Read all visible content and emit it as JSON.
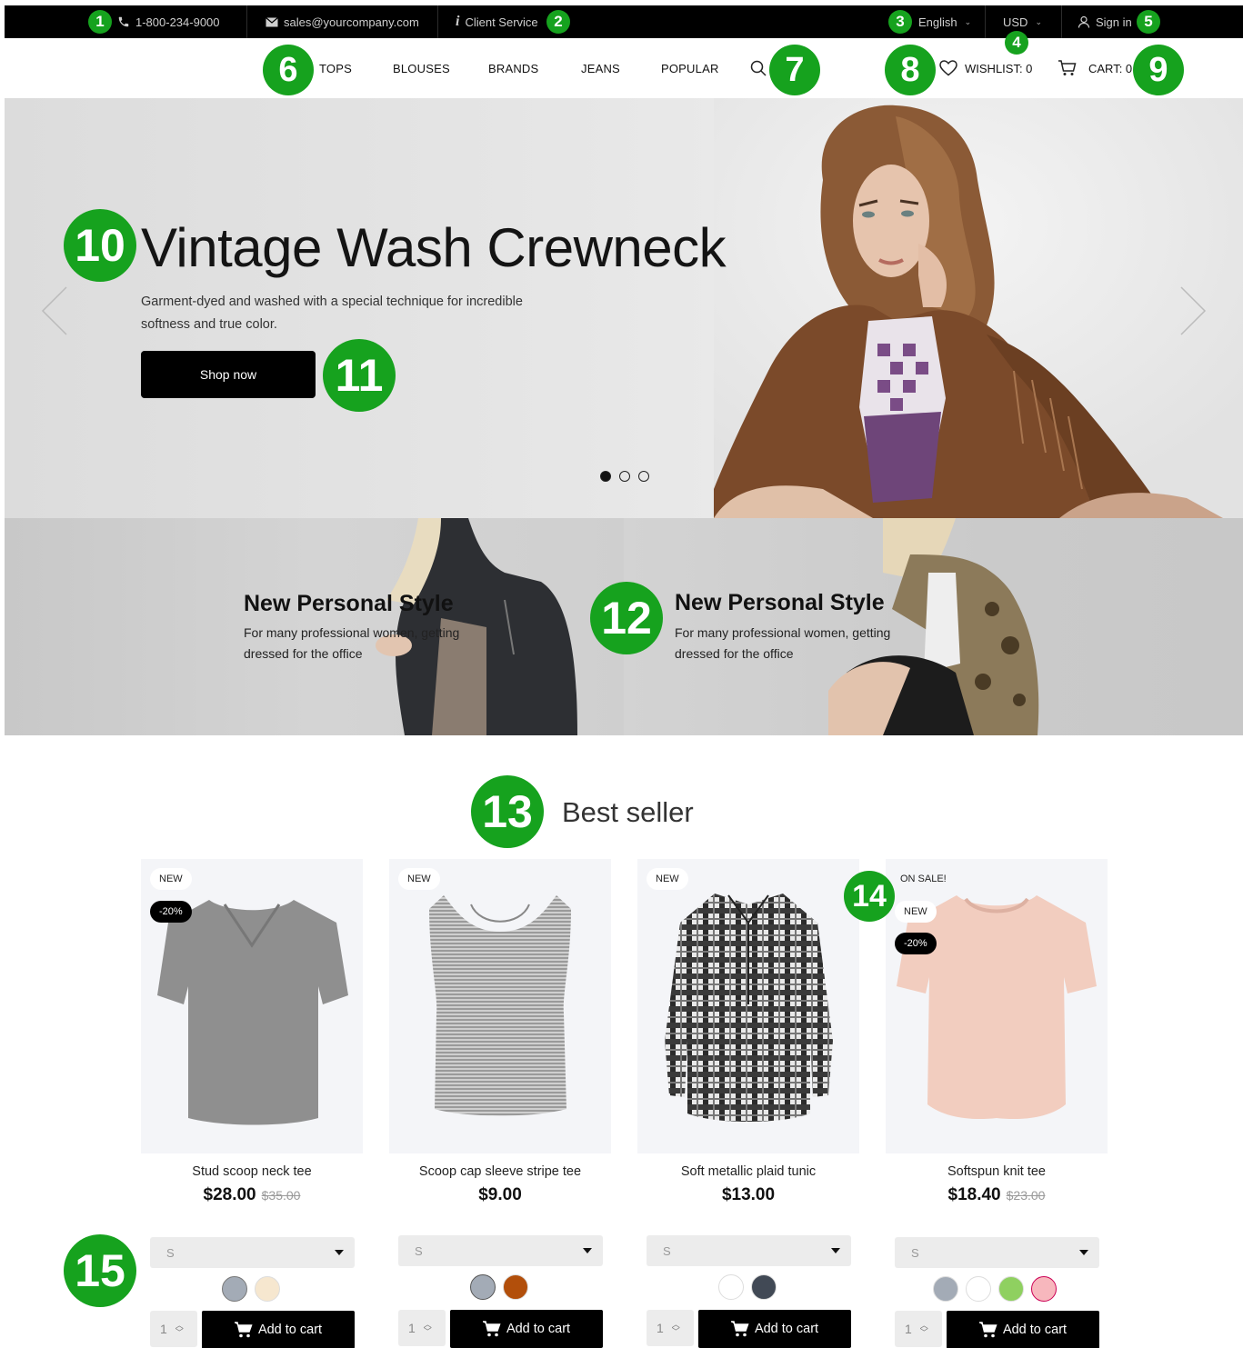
{
  "topbar": {
    "phone": "1-800-234-9000",
    "email": "sales@yourcompany.com",
    "client_service": "Client Service",
    "language": "English",
    "currency": "USD",
    "sign_in": "Sign in"
  },
  "nav": {
    "links": [
      "TOPS",
      "BLOUSES",
      "BRANDS",
      "JEANS",
      "POPULAR"
    ],
    "wishlist": "WISHLIST: 0",
    "cart": "CART: 0"
  },
  "hero": {
    "title": "Vintage Wash Crewneck",
    "description": "Garment-dyed and washed with a special technique for incredible softness and true color.",
    "button": "Shop now",
    "slide_count": 3,
    "active_slide": 1
  },
  "banners": [
    {
      "title": "New Personal Style",
      "subtitle": "For many professional women, getting dressed for the office"
    },
    {
      "title": "New Personal Style",
      "subtitle": "For many professional women, getting dressed for the office"
    }
  ],
  "best_seller": {
    "title": "Best seller",
    "add_to_cart_label": "Add to cart",
    "products": [
      {
        "name": "Stud scoop neck tee",
        "price": "$28.00",
        "old_price": "$35.00",
        "badges": [
          "NEW",
          "-20%"
        ],
        "size": "S",
        "qty": "1",
        "swatches": [
          "#a3abb6",
          "#f6e7cf"
        ]
      },
      {
        "name": "Scoop cap sleeve stripe tee",
        "price": "$9.00",
        "old_price": "",
        "badges": [
          "NEW"
        ],
        "size": "S",
        "qty": "1",
        "swatches": [
          "#a3abb6",
          "#b24f0b"
        ]
      },
      {
        "name": "Soft metallic plaid tunic",
        "price": "$13.00",
        "old_price": "",
        "badges": [
          "NEW"
        ],
        "size": "S",
        "qty": "1",
        "swatches": [
          "#ffffff",
          "#414955"
        ]
      },
      {
        "name": "Softspun knit tee",
        "price": "$18.40",
        "old_price": "$23.00",
        "badges": [
          "ON SALE!",
          "NEW",
          "-20%"
        ],
        "size": "S",
        "qty": "1",
        "swatches": [
          "#a3abb6",
          "#ffffff",
          "#8fd060",
          "#f7b7bd"
        ]
      }
    ]
  },
  "callouts": [
    "1",
    "2",
    "3",
    "4",
    "5",
    "6",
    "7",
    "8",
    "9",
    "10",
    "11",
    "12",
    "13",
    "14",
    "15"
  ],
  "colors": {
    "callout": "#16a21e",
    "topbar": "#000000",
    "button": "#000000"
  }
}
